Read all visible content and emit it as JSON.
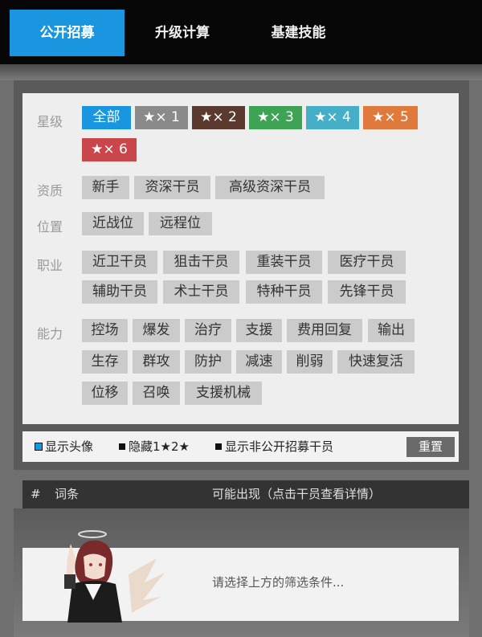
{
  "tabs": [
    {
      "label": "公开招募",
      "active": true
    },
    {
      "label": "升级计算",
      "active": false
    },
    {
      "label": "基建技能",
      "active": false
    }
  ],
  "filters": {
    "star": {
      "label": "星级",
      "chips": [
        {
          "label": "全部",
          "color": "#1a96e0"
        },
        {
          "label": "★× 1",
          "color": "#8a8a8a"
        },
        {
          "label": "★× 2",
          "color": "#5a3a2e"
        },
        {
          "label": "★× 3",
          "color": "#3fa356"
        },
        {
          "label": "★× 4",
          "color": "#46aec7"
        },
        {
          "label": "★× 5",
          "color": "#e07a3c"
        },
        {
          "label": "★× 6",
          "color": "#c9474a"
        }
      ]
    },
    "quality": {
      "label": "资质",
      "chips": [
        "新手",
        "资深干员",
        "高级资深干员"
      ]
    },
    "position": {
      "label": "位置",
      "chips": [
        "近战位",
        "远程位"
      ]
    },
    "profession": {
      "label": "职业",
      "chips": [
        "近卫干员",
        "狙击干员",
        "重装干员",
        "医疗干员",
        "辅助干员",
        "术士干员",
        "特种干员",
        "先锋干员"
      ]
    },
    "ability": {
      "label": "能力",
      "chips": [
        "控场",
        "爆发",
        "治疗",
        "支援",
        "费用回复",
        "输出",
        "生存",
        "群攻",
        "防护",
        "减速",
        "削弱",
        "快速复活",
        "位移",
        "召唤",
        "支援机械"
      ]
    }
  },
  "options": {
    "show_avatar": "显示头像",
    "hide_low_star": "隐藏1★2★",
    "show_non_public": "显示非公开招募干员",
    "reset": "重置"
  },
  "results": {
    "col_hash": "#",
    "col_tag": "词条",
    "col_possible": "可能出现（点击干员查看详情）",
    "empty_hint": "请选择上方的筛选条件..."
  }
}
